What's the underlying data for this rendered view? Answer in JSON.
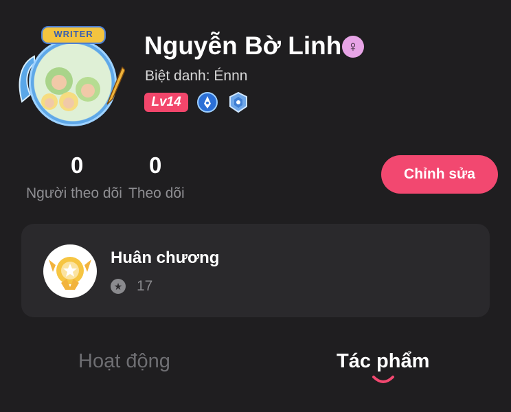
{
  "profile": {
    "avatar_frame_label": "WRITER",
    "name": "Nguyễn Bờ Linh",
    "gender_symbol": "♀",
    "nickname": "Biệt danh: Énnn",
    "level": "Lv14",
    "badges": [
      "pen-badge-icon",
      "shield-badge-icon"
    ]
  },
  "stats": {
    "followers_count": "0",
    "followers_label": "Người theo dõi",
    "following_count": "0",
    "following_label": "Theo dõi"
  },
  "actions": {
    "edit_label": "Chỉnh sửa"
  },
  "medals": {
    "title": "Huân chương",
    "count": "17"
  },
  "tabs": [
    {
      "label": "Hoạt động",
      "active": false
    },
    {
      "label": "Tác phẩm",
      "active": true
    }
  ],
  "colors": {
    "accent": "#f24870",
    "background": "#1f1e20",
    "card": "#2a292c"
  }
}
